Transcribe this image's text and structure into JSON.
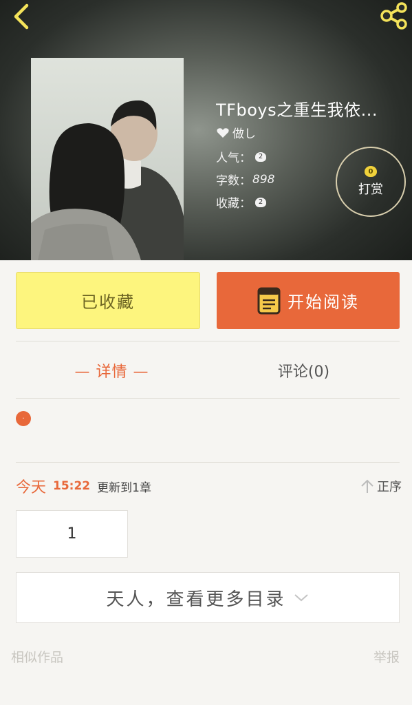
{
  "header": {
    "back_icon": "chevron-left-icon",
    "share_icon": "share-icon"
  },
  "book": {
    "title": "TFboys之重生我依...",
    "author": "做し",
    "popularity_label": "人气：",
    "popularity_value": "2",
    "word_count_label": "字数：",
    "word_count_value": "898",
    "collections_label": "收藏：",
    "collections_value": "2"
  },
  "tip": {
    "coin_value": "0",
    "label": "打赏"
  },
  "actions": {
    "collected_label": "已收藏",
    "read_label": "开始阅读"
  },
  "tabs": {
    "detail_label": "— 详情 —",
    "comments_label": "评论(0)"
  },
  "summary": {
    "badge": "·"
  },
  "update": {
    "day": "今天",
    "time": "15:22",
    "text": "更新到1章",
    "sort_label": "正序"
  },
  "chapters": [
    {
      "label": "1"
    }
  ],
  "catalog": {
    "more_label": "天人，查看更多目录"
  },
  "footer": {
    "similar_label": "相似作品",
    "report_label": "举报"
  },
  "colors": {
    "accent": "#e8683a",
    "collected_bg": "#fdf57e",
    "page_bg": "#f6f5f2"
  }
}
